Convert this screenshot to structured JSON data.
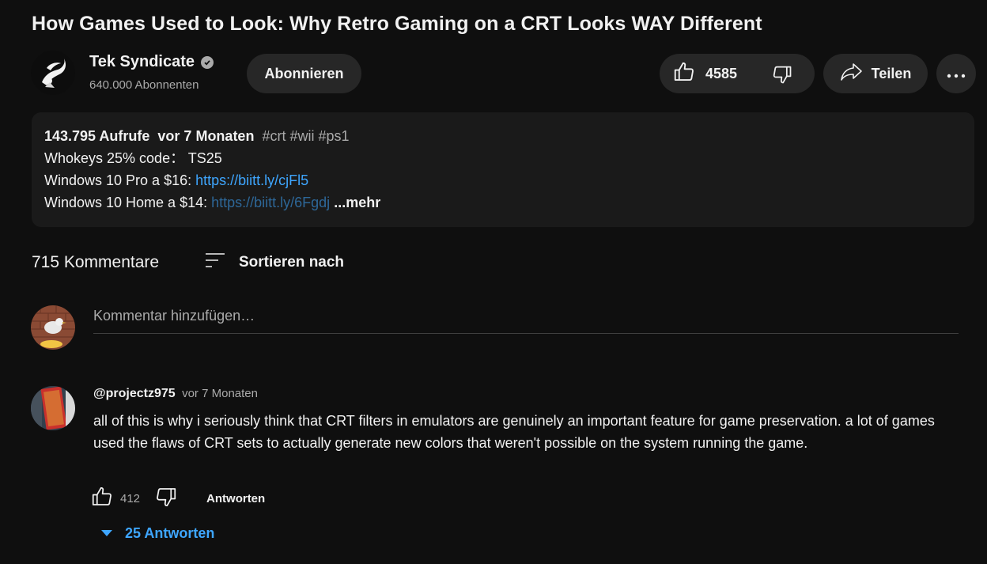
{
  "video": {
    "title": "How Games Used to Look: Why Retro Gaming on a CRT Looks WAY Different"
  },
  "channel": {
    "name": "Tek Syndicate",
    "subscribers": "640.000 Abonnenten",
    "subscribe_label": "Abonnieren"
  },
  "actions": {
    "likes": "4585",
    "share_label": "Teilen"
  },
  "description": {
    "views": "143.795 Aufrufe",
    "age": "vor 7 Monaten",
    "tags": "#crt #wii #ps1",
    "line1": "Whokeys 25% code： TS25",
    "line2_text": "Windows 10 Pro a $16: ",
    "line2_link": "https://biitt.ly/cjFl5",
    "line3_text": "Windows 10 Home a $14: ",
    "line3_link": "https://biitt.ly/6Fgdj",
    "more_label": "...mehr"
  },
  "comments": {
    "count_label": "715 Kommentare",
    "sort_label": "Sortieren nach",
    "add_placeholder": "Kommentar hinzufügen…",
    "items": [
      {
        "author": "@projectz975",
        "time": "vor 7 Monaten",
        "text": "all of this is why i seriously think that CRT filters in emulators are genuinely an important feature for game preservation. a lot of games used the flaws of CRT sets to actually generate new colors that weren't possible on the system running the game.",
        "likes": "412",
        "reply_label": "Antworten",
        "replies_label": "25 Antworten"
      }
    ]
  },
  "colors": {
    "background": "#0f0f0f",
    "button_bg": "#272727",
    "link": "#3ea6ff",
    "secondary_text": "#aaaaaa"
  }
}
